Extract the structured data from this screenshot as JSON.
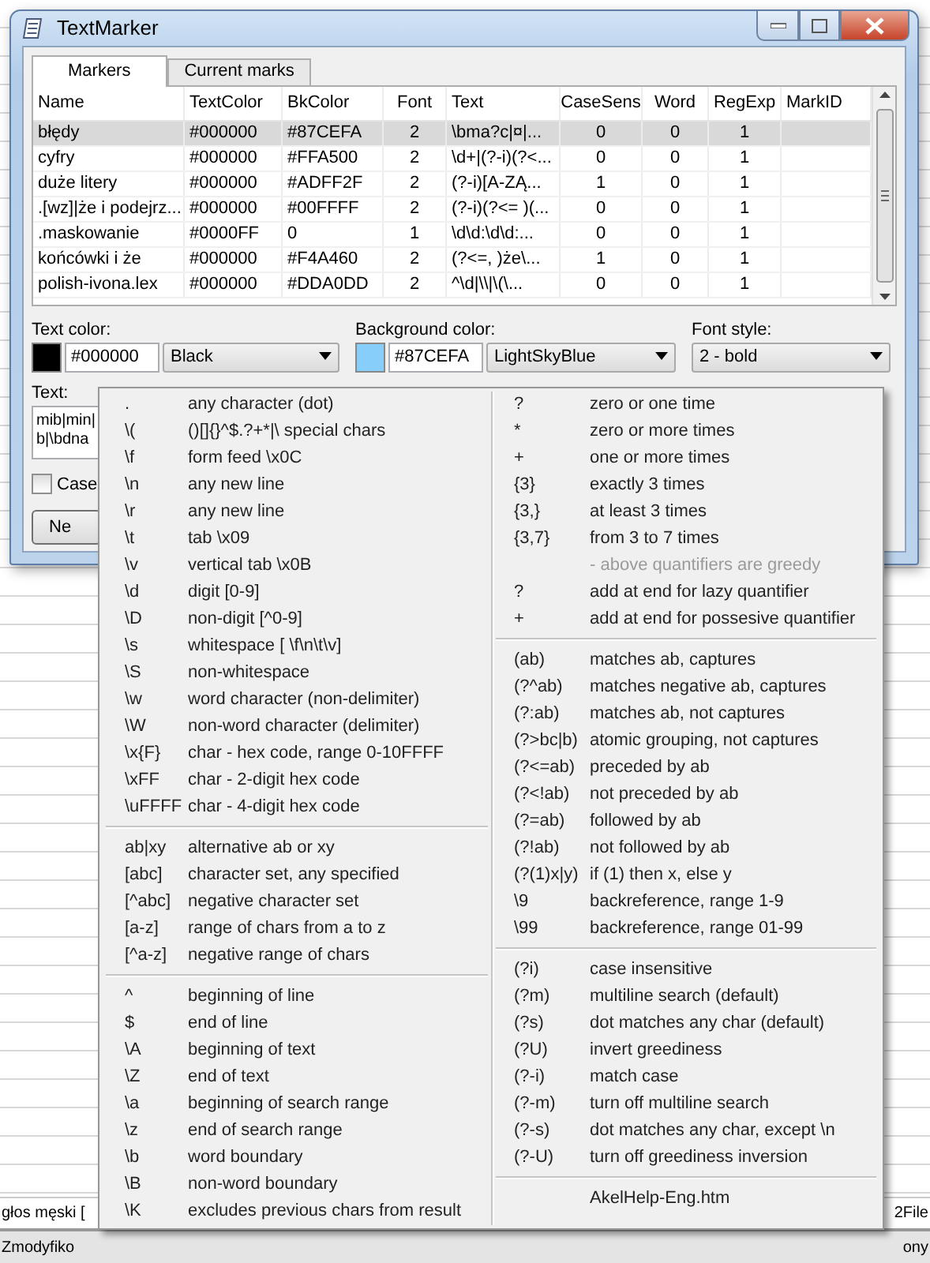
{
  "window": {
    "title": "TextMarker"
  },
  "tabs": [
    {
      "label": "Markers",
      "selected": true
    },
    {
      "label": "Current marks",
      "selected": false
    }
  ],
  "markers_table": {
    "columns": [
      "Name",
      "TextColor",
      "BkColor",
      "Font",
      "Text",
      "CaseSens",
      "Word",
      "RegExp",
      "MarkID"
    ],
    "rows": [
      {
        "cells": [
          "błędy",
          "#000000",
          "#87CEFA",
          "2",
          "\\bma?c|¤|...",
          "0",
          "0",
          "1"
        ],
        "selected": true
      },
      {
        "cells": [
          "cyfry",
          "#000000",
          "#FFA500",
          "2",
          "\\d+|(?-i)(?<...",
          "0",
          "0",
          "1"
        ],
        "selected": false
      },
      {
        "cells": [
          "duże litery",
          "#000000",
          "#ADFF2F",
          "2",
          "(?-i)[A-ZĄ...",
          "1",
          "0",
          "1"
        ],
        "selected": false
      },
      {
        "cells": [
          ".[wz]|że i podejrz...",
          "#000000",
          "#00FFFF",
          "2",
          "(?-i)(?<=  )(...",
          "0",
          "0",
          "1"
        ],
        "selected": false
      },
      {
        "cells": [
          ".maskowanie",
          "#0000FF",
          "0",
          "1",
          "\\d\\d:\\d\\d:...",
          "0",
          "0",
          "1"
        ],
        "selected": false
      },
      {
        "cells": [
          "końcówki i że",
          "#000000",
          "#F4A460",
          "2",
          "(?<=, )że\\...",
          "1",
          "0",
          "1"
        ],
        "selected": false
      },
      {
        "cells": [
          "polish-ivona.lex",
          "#000000",
          "#DDA0DD",
          "2",
          "^\\d|\\\\|\\(\\...",
          "0",
          "0",
          "1"
        ],
        "selected": false
      }
    ]
  },
  "text_color": {
    "label": "Text color:",
    "color": "#000000",
    "hex": "#000000",
    "name": "Black"
  },
  "background_color": {
    "label": "Background color:",
    "color": "#87cefa",
    "hex": "#87CEFA",
    "name": "LightSkyBlue"
  },
  "font_style": {
    "label": "Font style:",
    "value": "2 - bold"
  },
  "text": {
    "label": "Text:",
    "lines": [
      "mib|min|",
      "b|\\bdna"
    ]
  },
  "case_checkbox": {
    "label": "Case",
    "checked": false
  },
  "new_button": {
    "label": "Ne"
  },
  "behind": {
    "rows": [
      {
        "left": "głos męski [",
        "right": "2File"
      },
      {
        "left": "Zmodyfiko",
        "right": "ony"
      }
    ]
  },
  "regex_menu": {
    "columns": [
      {
        "sections": [
          [
            {
              "kind": "item",
              "key": ".",
              "desc": "any character (dot)"
            },
            {
              "kind": "item",
              "key": "\\(",
              "desc": "()[]{}^$.?+*|\\ special chars"
            },
            {
              "kind": "item",
              "key": "\\f",
              "desc": "form feed \\x0C"
            },
            {
              "kind": "item",
              "key": "\\n",
              "desc": "any new line"
            },
            {
              "kind": "item",
              "key": "\\r",
              "desc": "any new line"
            },
            {
              "kind": "item",
              "key": "\\t",
              "desc": "tab \\x09"
            },
            {
              "kind": "item",
              "key": "\\v",
              "desc": "vertical tab \\x0B"
            },
            {
              "kind": "item",
              "key": "\\d",
              "desc": "digit [0-9]"
            },
            {
              "kind": "item",
              "key": "\\D",
              "desc": "non-digit [^0-9]"
            },
            {
              "kind": "item",
              "key": "\\s",
              "desc": "whitespace [ \\f\\n\\t\\v]"
            },
            {
              "kind": "item",
              "key": "\\S",
              "desc": "non-whitespace"
            },
            {
              "kind": "item",
              "key": "\\w",
              "desc": "word character (non-delimiter)"
            },
            {
              "kind": "item",
              "key": "\\W",
              "desc": "non-word character (delimiter)"
            },
            {
              "kind": "item",
              "key": "\\x{F}",
              "desc": "char - hex code, range 0-10FFFF"
            },
            {
              "kind": "item",
              "key": "\\xFF",
              "desc": "char - 2-digit hex code"
            },
            {
              "kind": "item",
              "key": "\\uFFFF",
              "desc": "char - 4-digit hex code"
            }
          ],
          [
            {
              "kind": "item",
              "key": "ab|xy",
              "desc": "alternative ab or xy"
            },
            {
              "kind": "item",
              "key": "[abc]",
              "desc": "character set, any specified"
            },
            {
              "kind": "item",
              "key": "[^abc]",
              "desc": "negative character set"
            },
            {
              "kind": "item",
              "key": "[a-z]",
              "desc": "range of chars from a to z"
            },
            {
              "kind": "item",
              "key": "[^a-z]",
              "desc": "negative range of chars"
            }
          ],
          [
            {
              "kind": "item",
              "key": "^",
              "desc": "beginning of line"
            },
            {
              "kind": "item",
              "key": "$",
              "desc": "end of line"
            },
            {
              "kind": "item",
              "key": "\\A",
              "desc": "beginning of text"
            },
            {
              "kind": "item",
              "key": "\\Z",
              "desc": "end of text"
            },
            {
              "kind": "item",
              "key": "\\a",
              "desc": "beginning of search range"
            },
            {
              "kind": "item",
              "key": "\\z",
              "desc": "end of search range"
            },
            {
              "kind": "item",
              "key": "\\b",
              "desc": "word boundary"
            },
            {
              "kind": "item",
              "key": "\\B",
              "desc": "non-word boundary"
            },
            {
              "kind": "item",
              "key": "\\K",
              "desc": "excludes previous chars from result"
            }
          ]
        ]
      },
      {
        "sections": [
          [
            {
              "kind": "item",
              "key": "?",
              "desc": "zero or one time"
            },
            {
              "kind": "item",
              "key": "*",
              "desc": "zero or more times"
            },
            {
              "kind": "item",
              "key": "+",
              "desc": "one or more times"
            },
            {
              "kind": "item",
              "key": "{3}",
              "desc": "exactly 3 times"
            },
            {
              "kind": "item",
              "key": "{3,}",
              "desc": "at least 3 times"
            },
            {
              "kind": "item",
              "key": "{3,7}",
              "desc": "from 3 to 7 times"
            },
            {
              "kind": "note",
              "desc": "- above quantifiers are greedy"
            },
            {
              "kind": "item",
              "key": "?",
              "desc": "add at end for lazy quantifier"
            },
            {
              "kind": "item",
              "key": "+",
              "desc": "add at end for possesive quantifier"
            }
          ],
          [
            {
              "kind": "item",
              "key": "(ab)",
              "desc": "matches ab, captures"
            },
            {
              "kind": "item",
              "key": "(?^ab)",
              "desc": "matches negative ab, captures"
            },
            {
              "kind": "item",
              "key": "(?:ab)",
              "desc": "matches ab, not captures"
            },
            {
              "kind": "item",
              "key": "(?>bc|b)",
              "desc": "atomic grouping, not captures"
            },
            {
              "kind": "item",
              "key": "(?<=ab)",
              "desc": "preceded by ab"
            },
            {
              "kind": "item",
              "key": "(?<!ab)",
              "desc": "not preceded by ab"
            },
            {
              "kind": "item",
              "key": "(?=ab)",
              "desc": "followed by ab"
            },
            {
              "kind": "item",
              "key": "(?!ab)",
              "desc": "not followed by ab"
            },
            {
              "kind": "item",
              "key": "(?(1)x|y)",
              "desc": "if (1) then x, else y"
            },
            {
              "kind": "item",
              "key": "\\9",
              "desc": "backreference, range 1-9"
            },
            {
              "kind": "item",
              "key": "\\99",
              "desc": "backreference, range 01-99"
            }
          ],
          [
            {
              "kind": "item",
              "key": "(?i)",
              "desc": "case insensitive"
            },
            {
              "kind": "item",
              "key": "(?m)",
              "desc": "multiline search (default)"
            },
            {
              "kind": "item",
              "key": "(?s)",
              "desc": "dot matches any char (default)"
            },
            {
              "kind": "item",
              "key": "(?U)",
              "desc": "invert greediness"
            },
            {
              "kind": "item",
              "key": "(?-i)",
              "desc": "match case"
            },
            {
              "kind": "item",
              "key": "(?-m)",
              "desc": "turn off multiline search"
            },
            {
              "kind": "item",
              "key": "(?-s)",
              "desc": "dot matches any char, except \\n"
            },
            {
              "kind": "item",
              "key": "(?-U)",
              "desc": "turn off greediness inversion"
            }
          ],
          [
            {
              "kind": "item",
              "desc": "AkelHelp-Eng.htm"
            }
          ]
        ]
      }
    ]
  }
}
